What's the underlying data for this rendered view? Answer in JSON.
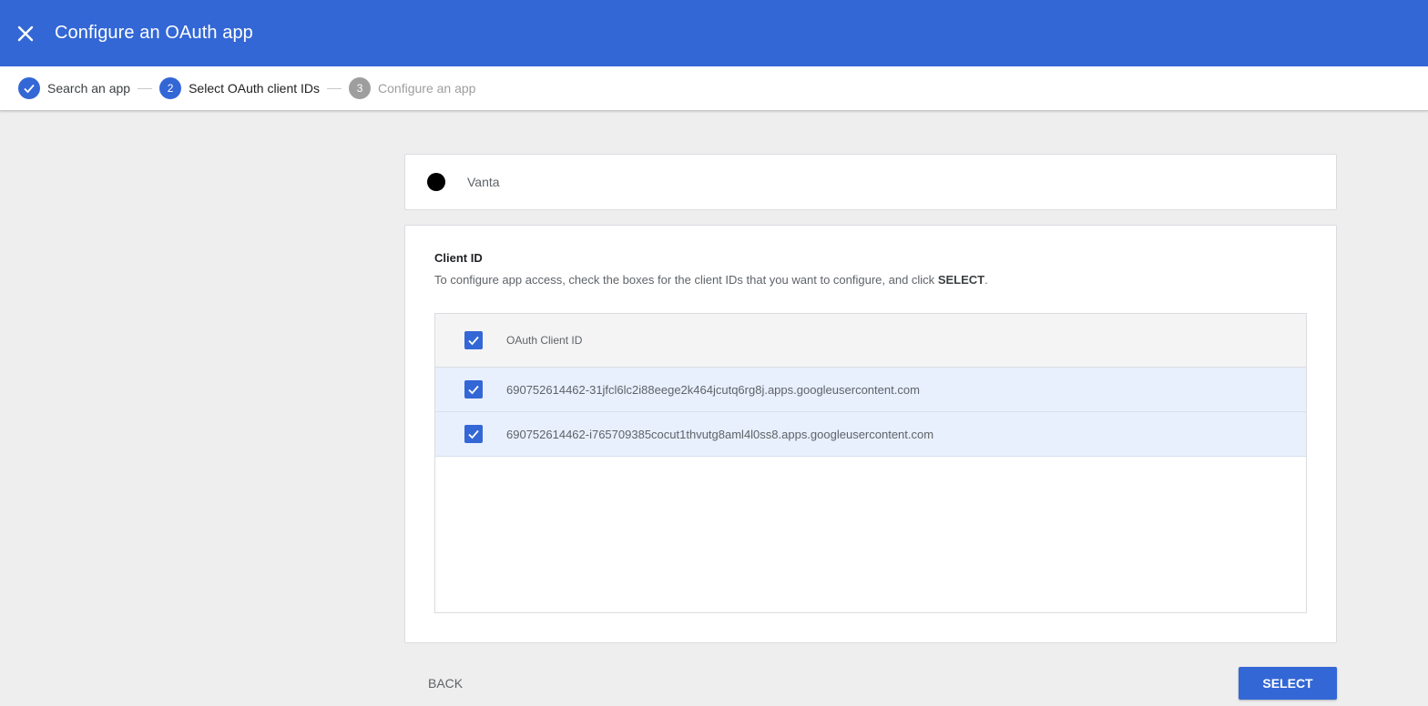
{
  "header": {
    "title": "Configure an OAuth app",
    "close_icon": "close-icon"
  },
  "stepper": {
    "steps": [
      {
        "label": "Search an app",
        "state": "done",
        "marker": ""
      },
      {
        "label": "Select OAuth client IDs",
        "state": "active",
        "marker": "2"
      },
      {
        "label": "Configure an app",
        "state": "pending",
        "marker": "3"
      }
    ]
  },
  "app": {
    "name": "Vanta"
  },
  "client": {
    "title": "Client ID",
    "description_prefix": "To configure app access, check the boxes for the client IDs that you want to configure, and click ",
    "description_bold": "SELECT",
    "description_suffix": ".",
    "table": {
      "header": "OAuth Client ID",
      "header_checked": true,
      "rows": [
        {
          "id": "690752614462-31jfcl6lc2i88eege2k464jcutq6rg8j.apps.googleusercontent.com",
          "checked": true
        },
        {
          "id": "690752614462-i765709385cocut1thvutg8aml4l0ss8.apps.googleusercontent.com",
          "checked": true
        }
      ]
    }
  },
  "actions": {
    "back_label": "BACK",
    "select_label": "SELECT"
  },
  "colors": {
    "primary": "#3367d6",
    "row_selected": "#e8f0fe",
    "pending": "#9e9e9e"
  }
}
